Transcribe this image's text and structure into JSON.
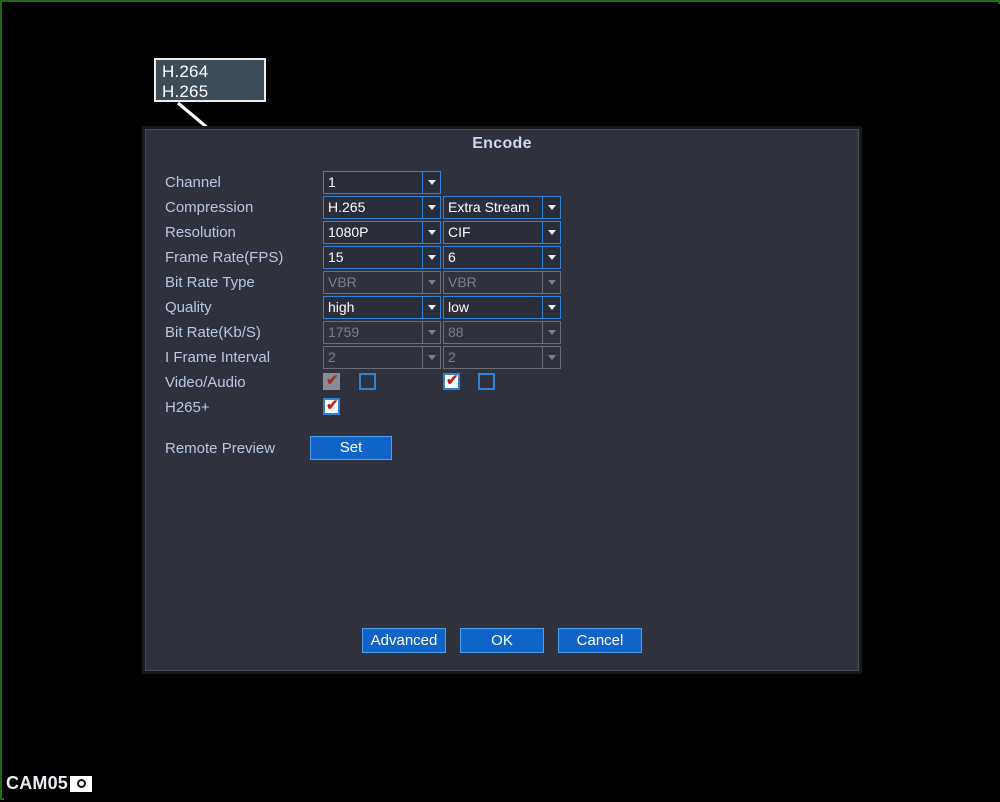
{
  "screen": {
    "border_color": "#1f6b16",
    "background": "#000000",
    "osd": {
      "channel_label": "CAM05",
      "record_icon": "record-dot-icon"
    }
  },
  "callout": {
    "name": "compression-options-callout",
    "options": [
      "H.264",
      "H.265"
    ],
    "pointer_icon": "arrow-pointer"
  },
  "dialog": {
    "title": "Encode",
    "background": "#2f313c",
    "accent": "#2f82d6",
    "rows": [
      {
        "label": "Channel",
        "main": {
          "value": "1",
          "enabled": true
        },
        "extra": null
      },
      {
        "label": "Compression",
        "main": {
          "value": "H.265",
          "enabled": true
        },
        "extra": {
          "value": "Extra Stream",
          "enabled": true
        }
      },
      {
        "label": "Resolution",
        "main": {
          "value": "1080P",
          "enabled": true
        },
        "extra": {
          "value": "CIF",
          "enabled": true
        }
      },
      {
        "label": "Frame Rate(FPS)",
        "main": {
          "value": "15",
          "enabled": true
        },
        "extra": {
          "value": "6",
          "enabled": true
        }
      },
      {
        "label": "Bit Rate Type",
        "main": {
          "value": "VBR",
          "enabled": false
        },
        "extra": {
          "value": "VBR",
          "enabled": false
        }
      },
      {
        "label": "Quality",
        "main": {
          "value": "high",
          "enabled": true
        },
        "extra": {
          "value": "low",
          "enabled": true
        }
      },
      {
        "label": "Bit Rate(Kb/S)",
        "main": {
          "value": "1759",
          "enabled": false
        },
        "extra": {
          "value": "88",
          "enabled": false
        }
      },
      {
        "label": "I Frame Interval",
        "main": {
          "value": "2",
          "enabled": false
        },
        "extra": {
          "value": "2",
          "enabled": false
        }
      }
    ],
    "video_audio": {
      "label": "Video/Audio",
      "main_video": {
        "checked": true,
        "enabled": false
      },
      "main_audio": {
        "checked": false,
        "enabled": true
      },
      "extra_video": {
        "checked": true,
        "enabled": true
      },
      "extra_audio": {
        "checked": false,
        "enabled": true
      },
      "check_glyph": "✔"
    },
    "h265plus": {
      "label": "H265+",
      "checked": true,
      "enabled": true,
      "check_glyph": "✔"
    },
    "remote_preview": {
      "label": "Remote Preview",
      "button_label": "Set"
    },
    "buttons": {
      "advanced": "Advanced",
      "ok": "OK",
      "cancel": "Cancel"
    }
  }
}
